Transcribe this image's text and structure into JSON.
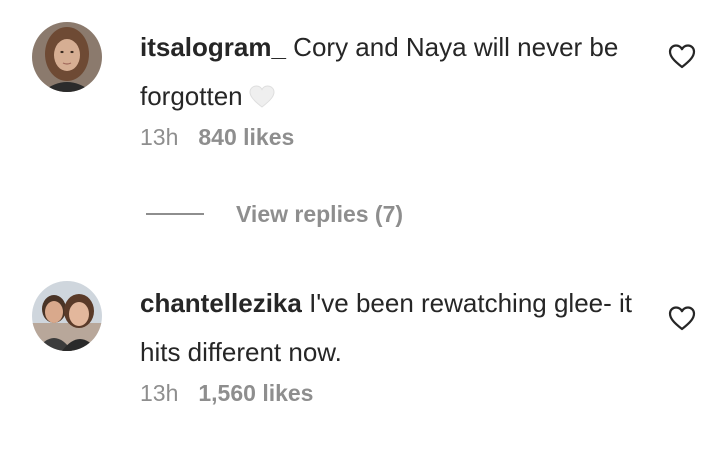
{
  "comments": [
    {
      "username": "itsalogram_",
      "text": " Cory and Naya will never be forgotten",
      "emoji": "white-heart-icon",
      "time": "13h",
      "likes": "840 likes",
      "avatar": "avatar-woman",
      "view_replies": "View replies (7)"
    },
    {
      "username": "chantellezika",
      "text": " I've been rewatching glee- it hits different now.",
      "time": "13h",
      "likes": "1,560 likes",
      "avatar": "avatar-couple"
    }
  ],
  "colors": {
    "text": "#262626",
    "secondary": "#8e8e8e",
    "background": "#ffffff"
  }
}
